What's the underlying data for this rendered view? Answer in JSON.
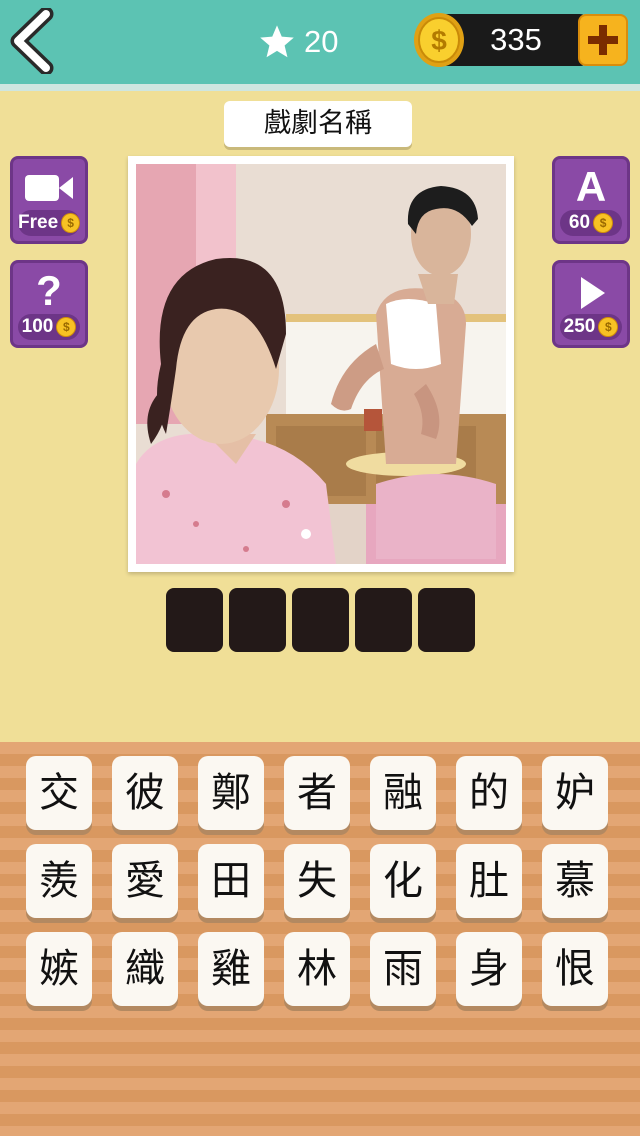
{
  "header": {
    "level": "20",
    "coins": "335"
  },
  "category_label": "戲劇名稱",
  "hints": {
    "video": {
      "cost": "Free"
    },
    "question": {
      "glyph": "?",
      "cost": "100"
    },
    "reveal_letter": {
      "glyph": "A",
      "cost": "60"
    },
    "skip": {
      "cost": "250"
    }
  },
  "answer_slots": [
    "",
    "",
    "",
    "",
    ""
  ],
  "letter_tiles": [
    [
      "交",
      "彼",
      "鄭",
      "者",
      "融",
      "的",
      "妒"
    ],
    [
      "羨",
      "愛",
      "田",
      "失",
      "化",
      "肚",
      "慕"
    ],
    [
      "嫉",
      "織",
      "雞",
      "林",
      "雨",
      "身",
      "恨"
    ]
  ],
  "colors": {
    "top_bar": "#5cc3b3",
    "background": "#f0df97",
    "hint_purple": "#8a4aa6",
    "slot": "#231918",
    "coin_gold": "#f7c224"
  }
}
